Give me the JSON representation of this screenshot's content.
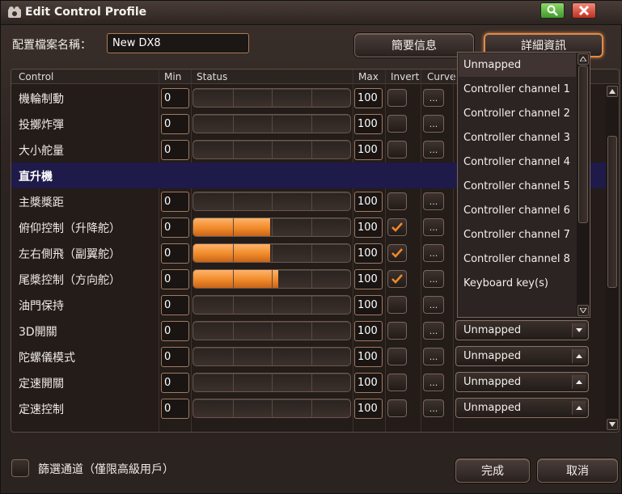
{
  "window": {
    "title": "Edit Control Profile"
  },
  "profile": {
    "name_label": "配置檔案名稱：",
    "name_value": "New DX8"
  },
  "top_buttons": {
    "summary": "簡要信息",
    "details": "詳細資訊"
  },
  "table": {
    "headers": {
      "control": "Control",
      "min": "Min",
      "status": "Status",
      "max": "Max",
      "invert": "Invert",
      "curve": "Curve"
    },
    "rows": [
      {
        "name": "機輪制動",
        "min": "0",
        "max": "100",
        "fill": 0,
        "inverted": false,
        "curve": "...",
        "mapping": ""
      },
      {
        "name": "投擲炸彈",
        "min": "0",
        "max": "100",
        "fill": 0,
        "inverted": false,
        "curve": "...",
        "mapping": ""
      },
      {
        "name": "大小舵量",
        "min": "0",
        "max": "100",
        "fill": 0,
        "inverted": false,
        "curve": "...",
        "mapping": ""
      },
      {
        "name": "直升機",
        "section": true
      },
      {
        "name": "主槳槳距",
        "min": "0",
        "max": "100",
        "fill": 0,
        "inverted": false,
        "curve": "...",
        "mapping": ""
      },
      {
        "name": "俯仰控制（升降舵）",
        "min": "0",
        "max": "100",
        "fill": 0.49,
        "inverted": true,
        "curve": "...",
        "mapping": ""
      },
      {
        "name": "左右側飛（副翼舵）",
        "min": "0",
        "max": "100",
        "fill": 0.49,
        "inverted": true,
        "curve": "...",
        "mapping": ""
      },
      {
        "name": "尾槳控制（方向舵）",
        "min": "0",
        "max": "100",
        "fill": 0.54,
        "inverted": true,
        "curve": "...",
        "mapping": ""
      },
      {
        "name": "油門保持",
        "min": "0",
        "max": "100",
        "fill": 0,
        "inverted": false,
        "curve": "...",
        "mapping": ""
      },
      {
        "name": "3D開關",
        "min": "0",
        "max": "100",
        "fill": 0,
        "inverted": false,
        "curve": "...",
        "mapping": "Unmapped",
        "arrow": "down"
      },
      {
        "name": "陀螺儀模式",
        "min": "0",
        "max": "100",
        "fill": 0,
        "inverted": false,
        "curve": "...",
        "mapping": "Unmapped",
        "arrow": "up"
      },
      {
        "name": "定速開關",
        "min": "0",
        "max": "100",
        "fill": 0,
        "inverted": false,
        "curve": "...",
        "mapping": "Unmapped",
        "arrow": "up"
      },
      {
        "name": "定速控制",
        "min": "0",
        "max": "100",
        "fill": 0,
        "inverted": false,
        "curve": "...",
        "mapping": "Unmapped",
        "arrow": "up"
      }
    ]
  },
  "dropdown": {
    "options": [
      "Unmapped",
      "Controller channel 1",
      "Controller channel 2",
      "Controller channel 3",
      "Controller channel 4",
      "Controller channel 5",
      "Controller channel 6",
      "Controller channel 7",
      "Controller channel 8",
      "Keyboard key(s)"
    ],
    "selected_index": 0
  },
  "footer": {
    "filter_label": "篩選通道（僅限高級用戶）",
    "done": "完成",
    "cancel": "取消"
  },
  "colors": {
    "accent": "#e08a47",
    "fill": "#f08a2a",
    "section_bg": "#1e1a4a"
  }
}
